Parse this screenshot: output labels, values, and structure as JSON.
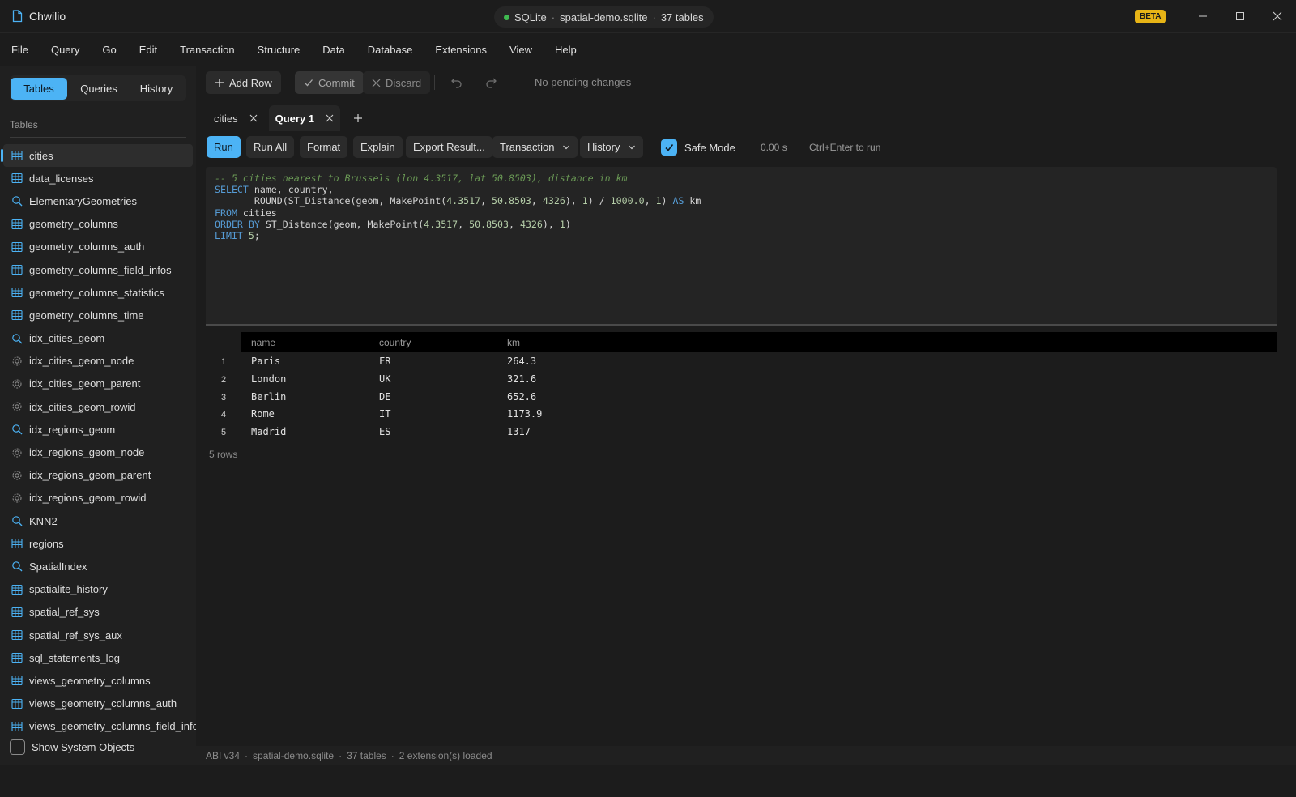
{
  "titlebar": {
    "app_name": "Chwilio",
    "engine": "SQLite",
    "separator": "·",
    "file": "spatial-demo.sqlite",
    "table_count": "37 tables",
    "badge": "BETA",
    "status_color": "#3fb950"
  },
  "menu": [
    "File",
    "Query",
    "Go",
    "Edit",
    "Transaction",
    "Structure",
    "Data",
    "Database",
    "Extensions",
    "View",
    "Help"
  ],
  "sidebar": {
    "tabs": [
      "Tables",
      "Queries",
      "History"
    ],
    "active_tab": "Tables",
    "heading": "Tables",
    "items": [
      {
        "label": "cities",
        "icon": "table-icon",
        "active": true
      },
      {
        "label": "data_licenses",
        "icon": "table-icon"
      },
      {
        "label": "ElementaryGeometries",
        "icon": "search-icon"
      },
      {
        "label": "geometry_columns",
        "icon": "table-icon"
      },
      {
        "label": "geometry_columns_auth",
        "icon": "table-icon"
      },
      {
        "label": "geometry_columns_field_infos",
        "icon": "table-icon"
      },
      {
        "label": "geometry_columns_statistics",
        "icon": "table-icon"
      },
      {
        "label": "geometry_columns_time",
        "icon": "table-icon"
      },
      {
        "label": "idx_cities_geom",
        "icon": "search-icon"
      },
      {
        "label": "idx_cities_geom_node",
        "icon": "gear-icon"
      },
      {
        "label": "idx_cities_geom_parent",
        "icon": "gear-icon"
      },
      {
        "label": "idx_cities_geom_rowid",
        "icon": "gear-icon"
      },
      {
        "label": "idx_regions_geom",
        "icon": "search-icon"
      },
      {
        "label": "idx_regions_geom_node",
        "icon": "gear-icon"
      },
      {
        "label": "idx_regions_geom_parent",
        "icon": "gear-icon"
      },
      {
        "label": "idx_regions_geom_rowid",
        "icon": "gear-icon"
      },
      {
        "label": "KNN2",
        "icon": "search-icon"
      },
      {
        "label": "regions",
        "icon": "table-icon"
      },
      {
        "label": "SpatialIndex",
        "icon": "search-icon"
      },
      {
        "label": "spatialite_history",
        "icon": "table-icon"
      },
      {
        "label": "spatial_ref_sys",
        "icon": "table-icon"
      },
      {
        "label": "spatial_ref_sys_aux",
        "icon": "table-icon"
      },
      {
        "label": "sql_statements_log",
        "icon": "table-icon"
      },
      {
        "label": "views_geometry_columns",
        "icon": "table-icon"
      },
      {
        "label": "views_geometry_columns_auth",
        "icon": "table-icon"
      },
      {
        "label": "views_geometry_columns_field_info",
        "icon": "table-icon"
      }
    ],
    "show_system_objects": "Show System Objects"
  },
  "toolbar": {
    "add_row": "Add Row",
    "commit": "Commit",
    "discard": "Discard",
    "pending": "No pending changes"
  },
  "tabs": [
    {
      "label": "cities",
      "active": false
    },
    {
      "label": "Query 1",
      "active": true
    }
  ],
  "query_bar": {
    "run": "Run",
    "run_all": "Run All",
    "format": "Format",
    "explain": "Explain",
    "export": "Export Result...",
    "transaction": "Transaction",
    "history": "History",
    "safe_mode": "Safe Mode",
    "timing": "0.00 s",
    "hint": "Ctrl+Enter to run"
  },
  "editor": {
    "comment": "-- 5 cities nearest to Brussels (lon 4.3517, lat 50.8503), distance in km",
    "sql": [
      "SELECT name, country,",
      "       ROUND(ST_Distance(geom, MakePoint(4.3517, 50.8503, 4326), 1) / 1000.0, 1) AS km",
      "FROM cities",
      "ORDER BY ST_Distance(geom, MakePoint(4.3517, 50.8503, 4326), 1)",
      "LIMIT 5;"
    ]
  },
  "results": {
    "columns": [
      "name",
      "country",
      "km"
    ],
    "rows": [
      [
        "1",
        "Paris",
        "FR",
        "264.3"
      ],
      [
        "2",
        "London",
        "UK",
        "321.6"
      ],
      [
        "3",
        "Berlin",
        "DE",
        "652.6"
      ],
      [
        "4",
        "Rome",
        "IT",
        "1173.9"
      ],
      [
        "5",
        "Madrid",
        "ES",
        "1317"
      ]
    ],
    "row_count": "5 rows"
  },
  "statusbar": {
    "abi": "ABI v34",
    "file": "spatial-demo.sqlite",
    "tables": "37 tables",
    "extensions": "2 extension(s) loaded",
    "separator": "·"
  },
  "colors": {
    "accent": "#4cb3f5",
    "beta": "#e7b416",
    "background": "#1c1c1c"
  }
}
